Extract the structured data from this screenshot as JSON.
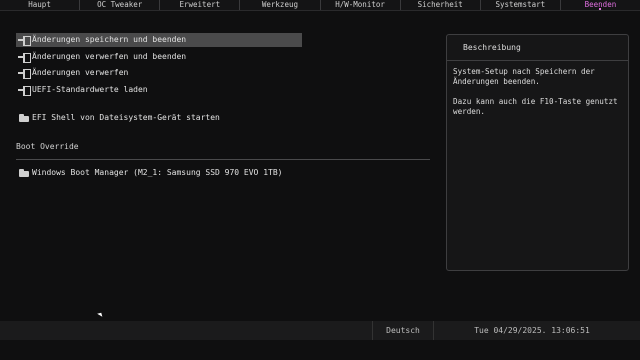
{
  "tabs": [
    {
      "label": "Haupt",
      "active": false
    },
    {
      "label": "OC Tweaker",
      "active": false
    },
    {
      "label": "Erweitert",
      "active": false
    },
    {
      "label": "Werkzeug",
      "active": false
    },
    {
      "label": "H/W-Monitor",
      "active": false
    },
    {
      "label": "Sicherheit",
      "active": false
    },
    {
      "label": "Systemstart",
      "active": false
    },
    {
      "label": "Beenden",
      "active": true
    }
  ],
  "menu": {
    "items": [
      {
        "label": "Änderungen speichern und beenden",
        "icon": "exit-icon",
        "selected": true
      },
      {
        "label": "Änderungen verwerfen und beenden",
        "icon": "exit-icon",
        "selected": false
      },
      {
        "label": "Änderungen verwerfen",
        "icon": "exit-icon",
        "selected": false
      },
      {
        "label": "UEFI-Standardwerte laden",
        "icon": "exit-icon",
        "selected": false
      }
    ],
    "efi_shell": {
      "label": "EFI Shell von Dateisystem-Gerät starten",
      "icon": "folder-icon"
    }
  },
  "boot_override": {
    "title": "Boot Override",
    "items": [
      {
        "label": "Windows Boot Manager (M2_1: Samsung SSD 970 EVO 1TB)",
        "icon": "folder-icon"
      }
    ]
  },
  "description": {
    "title": "Beschreibung",
    "paragraphs": [
      "System-Setup nach Speichern der Änderungen beenden.",
      "Dazu kann auch die F10-Taste genutzt werden."
    ]
  },
  "status": {
    "language": "Deutsch",
    "datetime": "Tue 04/29/2025. 13:06:51"
  },
  "colors": {
    "accent": "#e06fe0",
    "background": "#0f0f10",
    "selected_row": "#4a4a4b"
  }
}
